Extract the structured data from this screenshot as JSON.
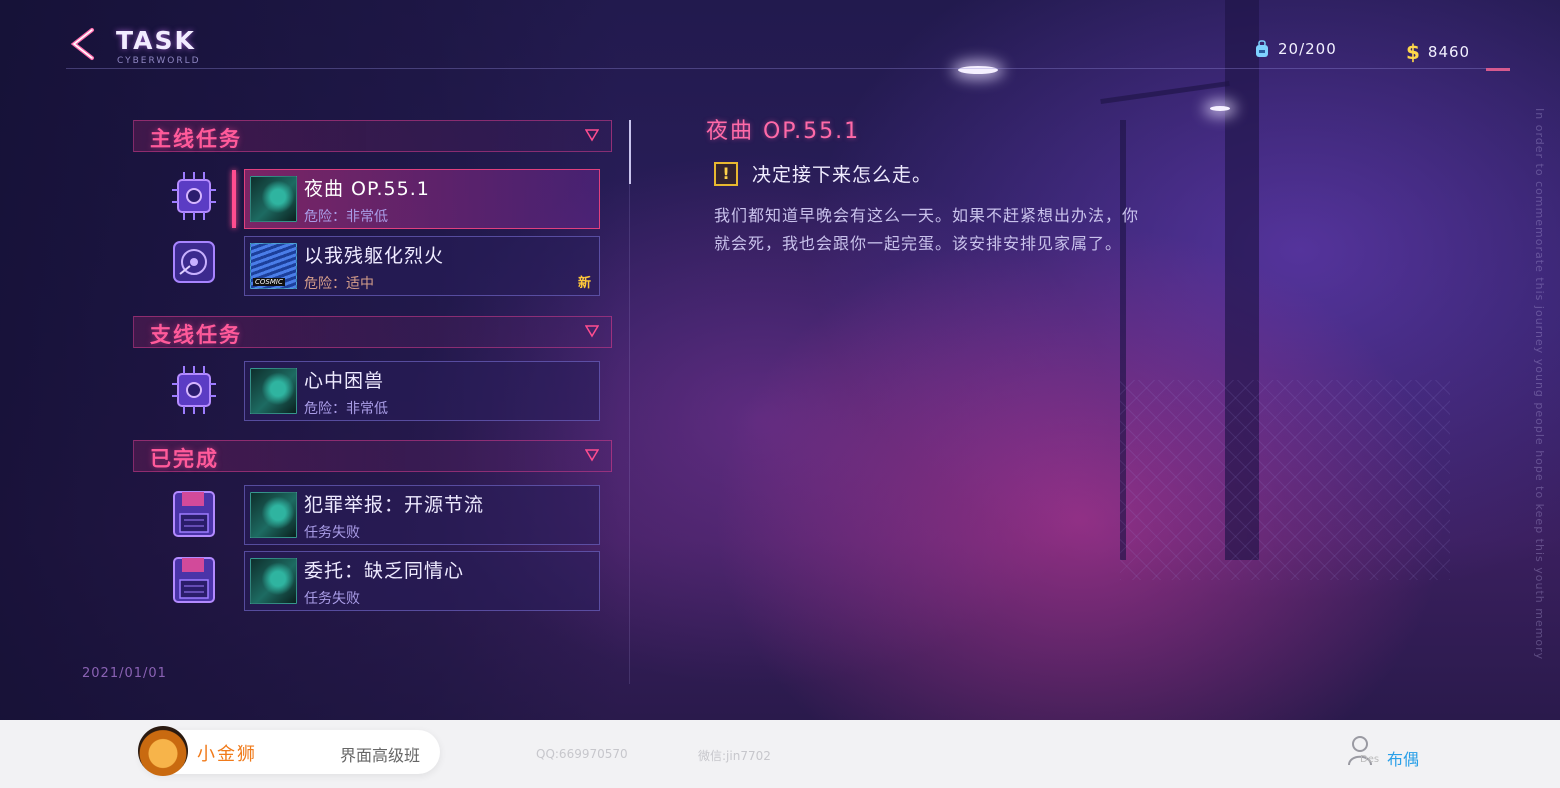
{
  "header": {
    "title": "TASK",
    "subtitle": "CYBERWORLD",
    "inventory": {
      "icon": "backpack-icon",
      "value": "20/200"
    },
    "money": {
      "icon": "dollar-icon",
      "value": "8460"
    }
  },
  "categories": {
    "main": {
      "label": "主线任务"
    },
    "side": {
      "label": "支线任务"
    },
    "done": {
      "label": "已完成"
    }
  },
  "tasks": [
    {
      "name": "夜曲  OP.55.1",
      "status": "危险：非常低",
      "selected": true
    },
    {
      "name": "以我残躯化烈火",
      "status": "危险：适中",
      "badge": "新"
    },
    {
      "name": "心中困兽",
      "status": "危险：非常低"
    },
    {
      "name": "犯罪举报：开源节流",
      "status": "任务失败"
    },
    {
      "name": "委托：缺乏同情心",
      "status": "任务失败"
    }
  ],
  "detail": {
    "title": "夜曲  OP.55.1",
    "goal": "决定接下来怎么走。",
    "description": "我们都知道早晚会有这么一天。如果不赶紧想出办法，你就会死，我也会跟你一起完蛋。该安排安排见家属了。"
  },
  "date": "2021/01/01",
  "side_text": "In order to commemorate this journey young people hope to keep this youth memory",
  "footer": {
    "brand": "小金狮",
    "course": "界面高级班",
    "qq": "QQ:669970570",
    "wechat": "微信:jin7702",
    "des_label": "Des",
    "author": "布偶"
  },
  "colors": {
    "accent_pink": "#ff5a9a",
    "accent_purple": "#7d4fe0",
    "warning": "#ffd24a",
    "new_badge": "#ffc83a"
  }
}
